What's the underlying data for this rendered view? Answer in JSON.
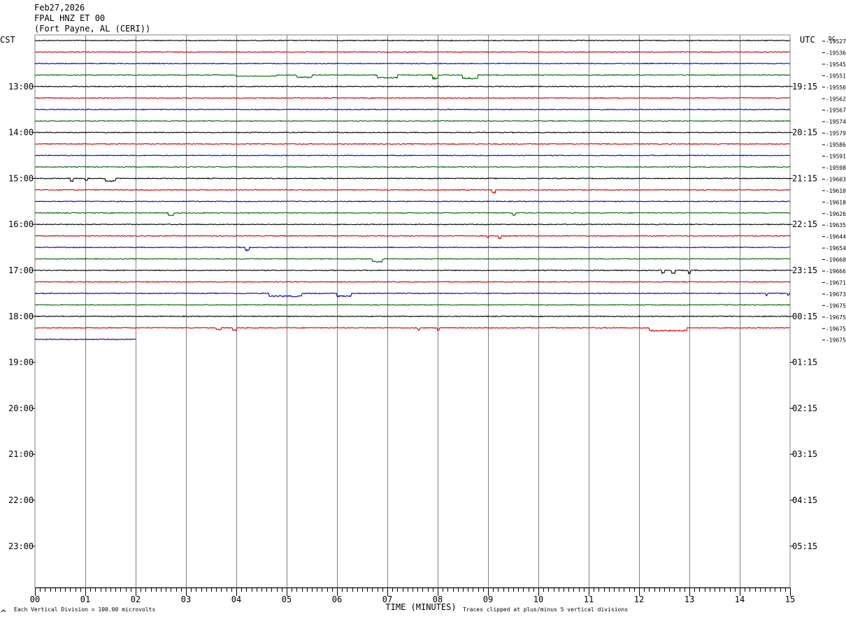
{
  "header": {
    "date": "Feb27,2026",
    "channel": "FPAL HNZ ET 00",
    "location": "(Fort Payne, AL (CERI))"
  },
  "chart_data": {
    "type": "line",
    "title": "",
    "left_zone": "CST",
    "right_zone": "UTC",
    "dc_label": "DC",
    "xlabel": "TIME (MINUTES)",
    "xlim": [
      0,
      15
    ],
    "x_ticks": [
      "00",
      "01",
      "02",
      "03",
      "04",
      "05",
      "06",
      "07",
      "08",
      "09",
      "10",
      "11",
      "12",
      "13",
      "14",
      "15"
    ],
    "left_hour_labels": [
      "13:00",
      "14:00",
      "15:00",
      "16:00",
      "17:00",
      "18:00",
      "19:00",
      "20:00",
      "21:00",
      "22:00",
      "23:00"
    ],
    "right_hour_labels": [
      "19:15",
      "20:15",
      "21:15",
      "22:15",
      "23:15",
      "00:15",
      "01:15",
      "02:15",
      "03:15",
      "04:15",
      "05:15"
    ],
    "trace_colors": [
      "#000000",
      "#cc0000",
      "#0000cc",
      "#006600"
    ],
    "traces": [
      {
        "dc": "-19527",
        "end_minute": 15
      },
      {
        "dc": "-19536",
        "end_minute": 15
      },
      {
        "dc": "-19545",
        "end_minute": 15
      },
      {
        "dc": "-19551",
        "end_minute": 15,
        "events": [
          [
            4.0,
            4.8,
            2
          ],
          [
            5.2,
            5.5,
            4
          ],
          [
            6.8,
            7.2,
            5
          ],
          [
            7.9,
            8.0,
            6
          ],
          [
            8.5,
            8.8,
            6
          ]
        ]
      },
      {
        "dc": "-19556",
        "end_minute": 15
      },
      {
        "dc": "-19562",
        "end_minute": 15
      },
      {
        "dc": "-19567",
        "end_minute": 15
      },
      {
        "dc": "-19574",
        "end_minute": 15
      },
      {
        "dc": "-19579",
        "end_minute": 15
      },
      {
        "dc": "-19586",
        "end_minute": 15
      },
      {
        "dc": "-19591",
        "end_minute": 15
      },
      {
        "dc": "-19598",
        "end_minute": 15
      },
      {
        "dc": "-19603",
        "end_minute": 15,
        "events": [
          [
            0.7,
            0.75,
            5
          ],
          [
            1.0,
            1.05,
            3
          ],
          [
            1.4,
            1.6,
            5
          ]
        ]
      },
      {
        "dc": "-19610",
        "end_minute": 15,
        "events": [
          [
            9.08,
            9.15,
            5
          ]
        ]
      },
      {
        "dc": "-19618",
        "end_minute": 15
      },
      {
        "dc": "-19626",
        "end_minute": 15,
        "events": [
          [
            2.65,
            2.75,
            5
          ],
          [
            9.5,
            9.55,
            4
          ]
        ]
      },
      {
        "dc": "-19635",
        "end_minute": 15
      },
      {
        "dc": "-19644",
        "end_minute": 15,
        "events": [
          [
            8.98,
            9.02,
            3
          ],
          [
            9.2,
            9.25,
            4
          ]
        ]
      },
      {
        "dc": "-19654",
        "end_minute": 15,
        "events": [
          [
            4.18,
            4.25,
            5
          ]
        ]
      },
      {
        "dc": "-19660",
        "end_minute": 15,
        "events": [
          [
            6.7,
            6.9,
            5
          ]
        ]
      },
      {
        "dc": "-19666",
        "end_minute": 15,
        "events": [
          [
            12.45,
            12.5,
            5
          ],
          [
            12.65,
            12.72,
            5
          ],
          [
            12.98,
            13.02,
            5
          ]
        ]
      },
      {
        "dc": "-19671",
        "end_minute": 15
      },
      {
        "dc": "-19673",
        "end_minute": 15,
        "events": [
          [
            4.65,
            5.3,
            5
          ],
          [
            6.0,
            6.28,
            5
          ],
          [
            14.52,
            14.55,
            4
          ],
          [
            14.95,
            14.98,
            4
          ]
        ]
      },
      {
        "dc": "-19675",
        "end_minute": 15
      },
      {
        "dc": "-19675",
        "end_minute": 15
      },
      {
        "dc": "-19675",
        "end_minute": 15,
        "events": [
          [
            3.6,
            3.7,
            3
          ],
          [
            3.93,
            4.0,
            4
          ],
          [
            7.6,
            7.65,
            4
          ],
          [
            8.0,
            8.03,
            4
          ],
          [
            12.2,
            12.95,
            5
          ]
        ]
      },
      {
        "dc": "-19675",
        "end_minute": 2
      }
    ]
  },
  "footer": {
    "left_note": "Each Vertical Division =  100.00 microvolts",
    "right_note": "Traces clipped at plus/minus 5 vertical divisions"
  }
}
